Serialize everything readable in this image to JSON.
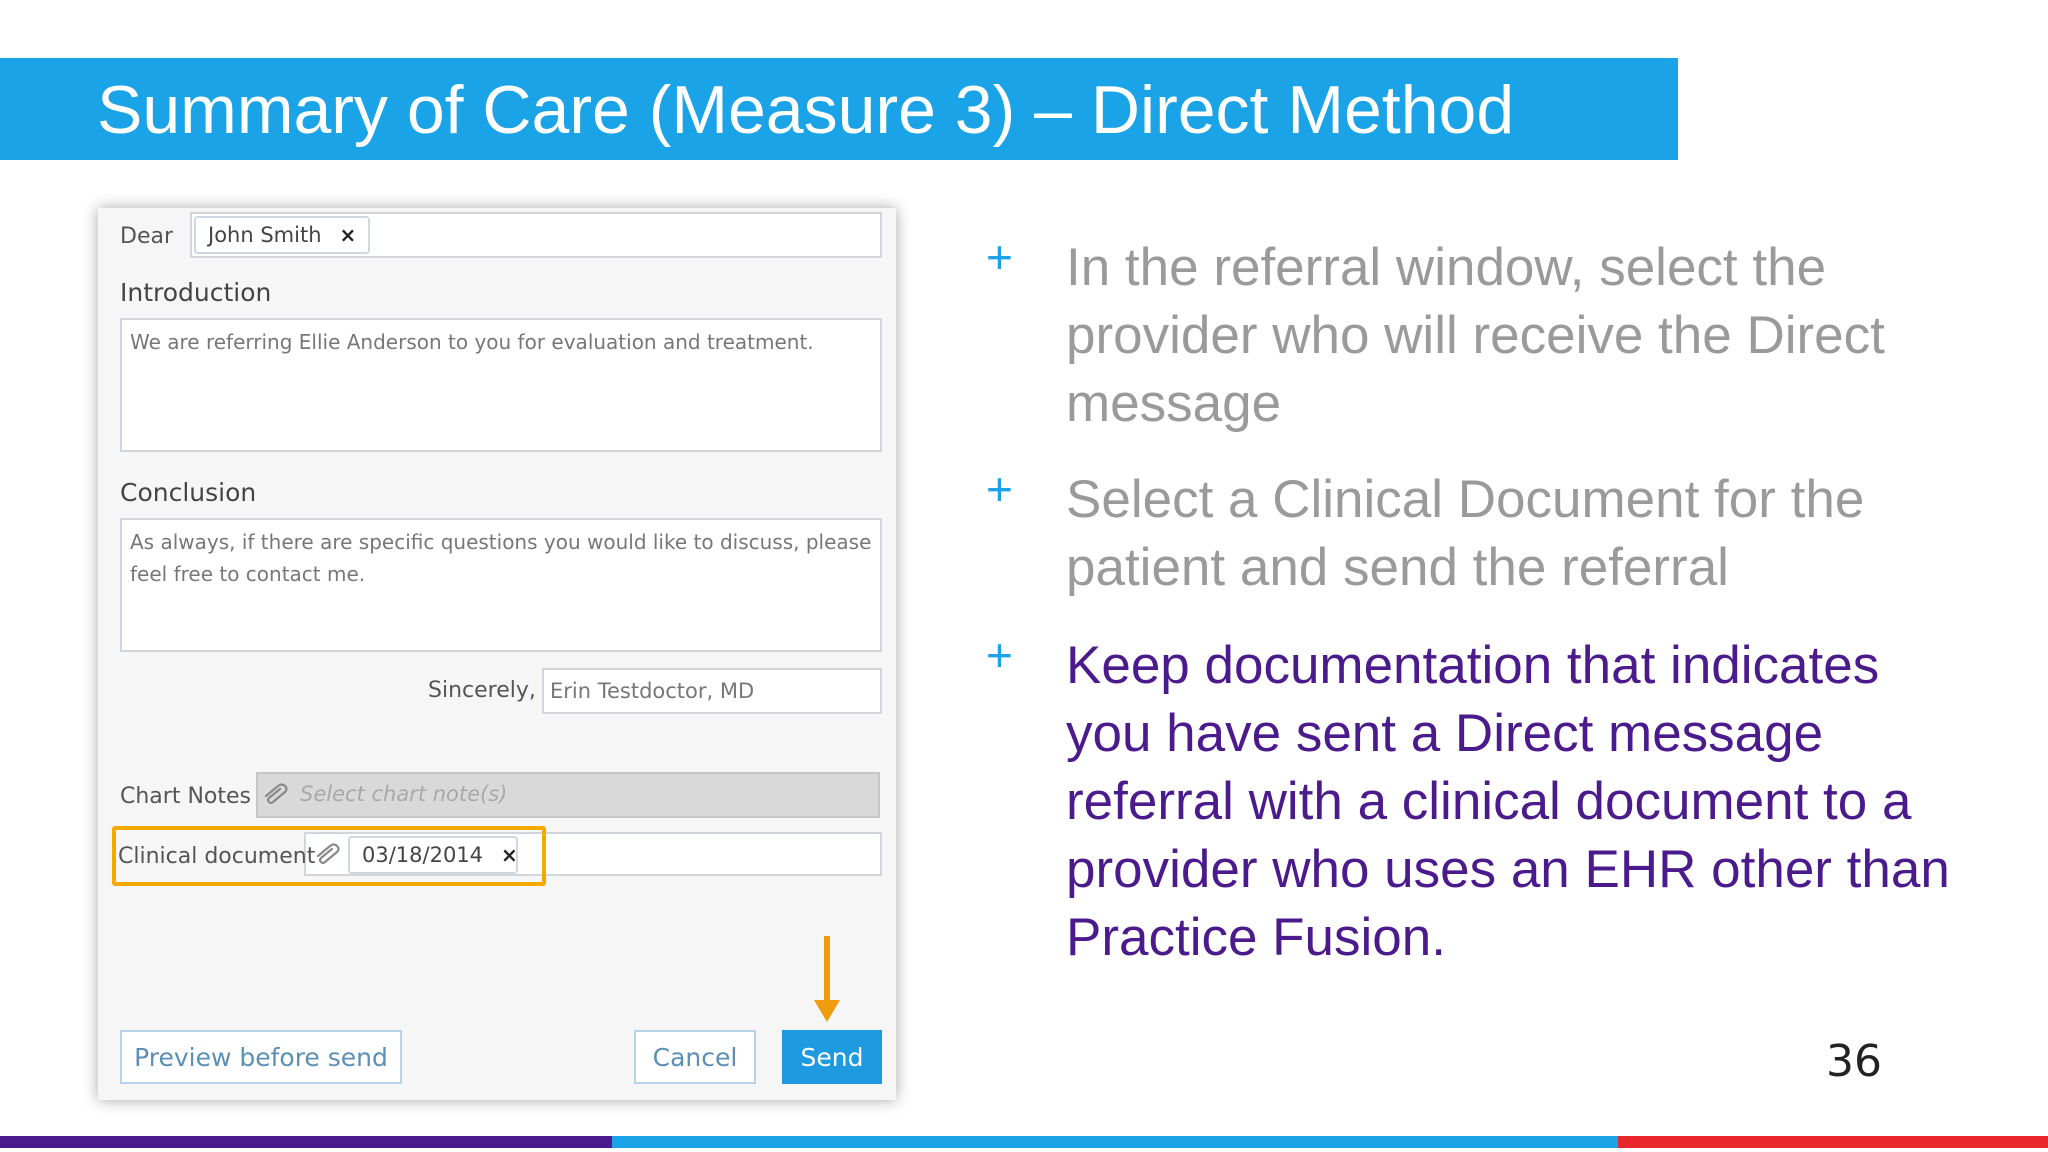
{
  "slide": {
    "title": "Summary of Care (Measure 3) – Direct Method",
    "page_number": "36",
    "colors": {
      "title_bar": "#1aa3e6",
      "grey_text": "#9a9a9a",
      "purple_text": "#4b1a8c",
      "highlight": "#f4a900",
      "arrow": "#f19b0f"
    }
  },
  "form": {
    "dear_label": "Dear",
    "recipient_tag": "John Smith",
    "remove_icon": "×",
    "introduction_label": "Introduction",
    "introduction_text": "We are referring Ellie Anderson to you for evaluation and treatment.",
    "conclusion_label": "Conclusion",
    "conclusion_text": "As always, if there are specific questions you would like to discuss, please feel free to contact me.",
    "sincerely_label": "Sincerely,",
    "sincerely_value": "Erin Testdoctor, MD",
    "chart_notes_label": "Chart Notes",
    "chart_notes_placeholder": "Select chart note(s)",
    "clinical_document_label": "Clinical document",
    "clinical_document_tag": "03/18/2014",
    "paperclip_icon": "paperclip-icon",
    "preview_button": "Preview before send",
    "cancel_button": "Cancel",
    "send_button": "Send"
  },
  "bullets": [
    {
      "marker": "+",
      "text": "In the referral window, select the provider who will receive the Direct message"
    },
    {
      "marker": "+",
      "text": "Select a Clinical Document for the patient and send the referral"
    },
    {
      "marker": "+",
      "text": "Keep documentation that indicates you have sent a Direct message referral with a clinical document to a provider who uses an EHR other than Practice Fusion."
    }
  ]
}
